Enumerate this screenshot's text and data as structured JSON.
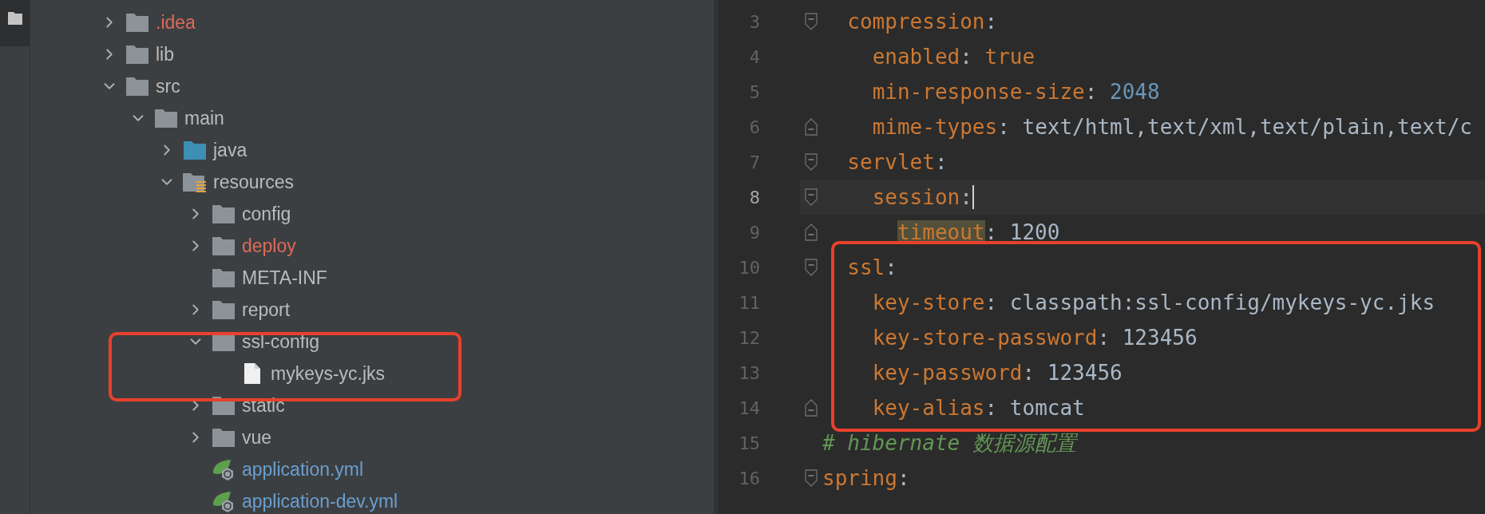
{
  "project_tree": {
    "items": [
      {
        "name": ".idea",
        "kind": "folder",
        "expanded": false,
        "color": "#de6a5a"
      },
      {
        "name": "lib",
        "kind": "folder",
        "expanded": false,
        "color": "#bbbbbb"
      },
      {
        "name": "src",
        "kind": "folder",
        "expanded": true,
        "color": "#bbbbbb",
        "children": [
          {
            "name": "main",
            "kind": "folder",
            "expanded": true,
            "color": "#bbbbbb",
            "children": [
              {
                "name": "java",
                "kind": "source-folder",
                "expanded": false,
                "color": "#bbbbbb"
              },
              {
                "name": "resources",
                "kind": "resource-folder",
                "expanded": true,
                "color": "#bbbbbb",
                "children": [
                  {
                    "name": "config",
                    "kind": "folder",
                    "expanded": false,
                    "color": "#bbbbbb"
                  },
                  {
                    "name": "deploy",
                    "kind": "folder",
                    "expanded": false,
                    "color": "#de6a5a"
                  },
                  {
                    "name": "META-INF",
                    "kind": "folder",
                    "color": "#bbbbbb"
                  },
                  {
                    "name": "report",
                    "kind": "folder",
                    "expanded": false,
                    "color": "#bbbbbb"
                  },
                  {
                    "name": "ssl-config",
                    "kind": "folder",
                    "expanded": true,
                    "color": "#bbbbbb",
                    "children": [
                      {
                        "name": "mykeys-yc.jks",
                        "kind": "file",
                        "color": "#bbbbbb"
                      }
                    ]
                  },
                  {
                    "name": "static",
                    "kind": "folder",
                    "expanded": false,
                    "color": "#bbbbbb"
                  },
                  {
                    "name": "vue",
                    "kind": "folder",
                    "expanded": false,
                    "color": "#bbbbbb"
                  },
                  {
                    "name": "application.yml",
                    "kind": "spring-config",
                    "color": "#6a9fd0"
                  },
                  {
                    "name": "application-dev.yml",
                    "kind": "spring-config",
                    "color": "#6a9fd0"
                  }
                ]
              }
            ]
          }
        ]
      }
    ]
  },
  "editor": {
    "lines": [
      {
        "number": "3",
        "current": false,
        "fold_start": true,
        "fold_end": false,
        "tokens": [
          {
            "kind": "key",
            "text": "  compression"
          },
          {
            "kind": "punct",
            "text": ":"
          }
        ]
      },
      {
        "number": "4",
        "current": false,
        "fold_start": false,
        "fold_end": false,
        "tokens": [
          {
            "kind": "key",
            "text": "    enabled"
          },
          {
            "kind": "punct",
            "text": ": "
          },
          {
            "kind": "keyword",
            "text": "true"
          }
        ]
      },
      {
        "number": "5",
        "current": false,
        "fold_start": false,
        "fold_end": false,
        "tokens": [
          {
            "kind": "key",
            "text": "    min-response-size"
          },
          {
            "kind": "punct",
            "text": ": "
          },
          {
            "kind": "number",
            "text": "2048"
          }
        ]
      },
      {
        "number": "6",
        "current": false,
        "fold_start": false,
        "fold_end": true,
        "tokens": [
          {
            "kind": "key",
            "text": "    mime-types"
          },
          {
            "kind": "punct",
            "text": ": "
          },
          {
            "kind": "value",
            "text": "text/html,text/xml,text/plain,text/c"
          }
        ]
      },
      {
        "number": "7",
        "current": false,
        "fold_start": true,
        "fold_end": false,
        "tokens": [
          {
            "kind": "key",
            "text": "  servlet"
          },
          {
            "kind": "punct",
            "text": ":"
          }
        ]
      },
      {
        "number": "8",
        "current": true,
        "caret": true,
        "fold_start": true,
        "fold_end": false,
        "tokens": [
          {
            "kind": "key",
            "text": "    session"
          },
          {
            "kind": "punct",
            "text": ":"
          }
        ]
      },
      {
        "number": "9",
        "current": false,
        "fold_start": false,
        "fold_end": true,
        "tokens": [
          {
            "kind": "key",
            "text": "      timeout",
            "highlighted": true
          },
          {
            "kind": "punct",
            "text": ": "
          },
          {
            "kind": "value",
            "text": "1200"
          }
        ]
      },
      {
        "number": "10",
        "current": false,
        "fold_start": true,
        "fold_end": false,
        "tokens": [
          {
            "kind": "key",
            "text": "  ssl"
          },
          {
            "kind": "punct",
            "text": ":"
          }
        ]
      },
      {
        "number": "11",
        "current": false,
        "fold_start": false,
        "fold_end": false,
        "tokens": [
          {
            "kind": "key",
            "text": "    key-store"
          },
          {
            "kind": "punct",
            "text": ": "
          },
          {
            "kind": "value",
            "text": "classpath:ssl-config/mykeys-yc.jks"
          }
        ]
      },
      {
        "number": "12",
        "current": false,
        "fold_start": false,
        "fold_end": false,
        "tokens": [
          {
            "kind": "key",
            "text": "    key-store-password"
          },
          {
            "kind": "punct",
            "text": ": "
          },
          {
            "kind": "value",
            "text": "123456"
          }
        ]
      },
      {
        "number": "13",
        "current": false,
        "fold_start": false,
        "fold_end": false,
        "tokens": [
          {
            "kind": "key",
            "text": "    key-password"
          },
          {
            "kind": "punct",
            "text": ": "
          },
          {
            "kind": "value",
            "text": "123456"
          }
        ]
      },
      {
        "number": "14",
        "current": false,
        "fold_start": false,
        "fold_end": true,
        "tokens": [
          {
            "kind": "key",
            "text": "    key-alias"
          },
          {
            "kind": "punct",
            "text": ": "
          },
          {
            "kind": "value",
            "text": "tomcat"
          }
        ]
      },
      {
        "number": "15",
        "current": false,
        "fold_start": false,
        "fold_end": false,
        "tokens": [
          {
            "kind": "comment",
            "text": "# hibernate 数据源配置"
          }
        ]
      },
      {
        "number": "16",
        "current": false,
        "fold_start": true,
        "fold_end": false,
        "tokens": [
          {
            "kind": "key",
            "text": "spring"
          },
          {
            "kind": "punct",
            "text": ":"
          }
        ]
      }
    ]
  }
}
